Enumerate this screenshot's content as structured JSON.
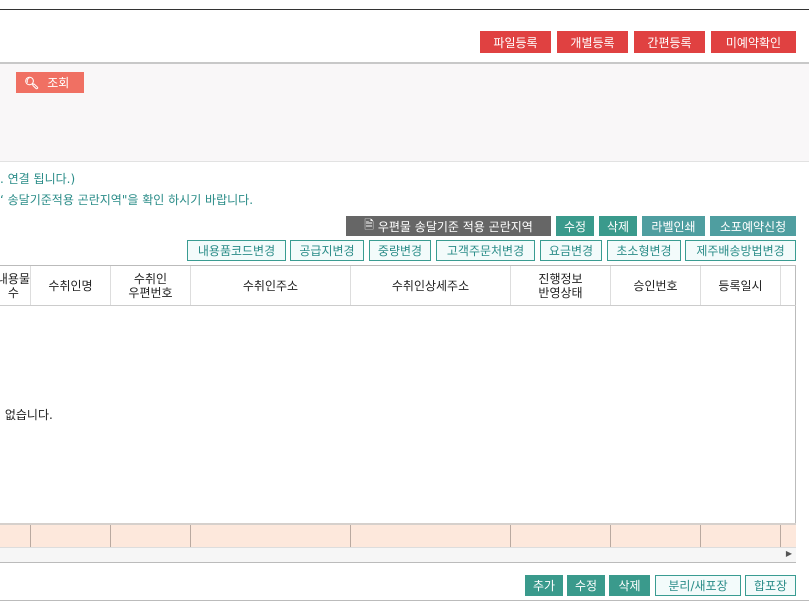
{
  "top_buttons": [
    "파일등록",
    "개별등록",
    "간편등록",
    "미예약확인"
  ],
  "search": {
    "button_label": "조회",
    "icon": "search-icon"
  },
  "notes": [
    ". 연결 됩니다.)",
    "‘ 송달기준적용 곤란지역\"을 확인 하시기 바랍니다."
  ],
  "action_buttons": {
    "area_label": "우편물 송달기준 적용 곤란지역",
    "edit": "수정",
    "delete": "삭제",
    "label_print": "라벨인쇄",
    "parcel_reserve": "소포예약신청"
  },
  "change_buttons": [
    "내용품코드변경",
    "공급지변경",
    "중량변경",
    "고객주문처변경",
    "요금변경",
    "초소형변경",
    "제주배송방법변경"
  ],
  "table": {
    "columns": [
      "내용물\n수",
      "수취인명",
      "수취인\n우편번호",
      "수취인주소",
      "수취인상세주소",
      "진행정보\n반영상태",
      "승인번호",
      "등록일시"
    ],
    "empty_message": "ㅏ 없습니다."
  },
  "bottom_buttons": {
    "add": "추가",
    "edit": "수정",
    "delete": "삭제",
    "split": "분리/새포장",
    "merge": "합포장"
  },
  "colors": {
    "red": "#e04141",
    "teal": "#3a9a8c",
    "dark": "#666666"
  }
}
